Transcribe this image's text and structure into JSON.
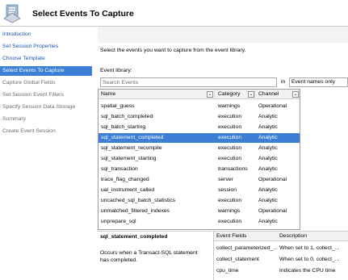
{
  "header": {
    "title": "Select Events To Capture"
  },
  "sidebar": {
    "items": [
      {
        "label": "Introduction",
        "state": "link"
      },
      {
        "label": "Set Session Properties",
        "state": "link"
      },
      {
        "label": "Choose Template",
        "state": "link"
      },
      {
        "label": "Select Events To Capture",
        "state": "active"
      },
      {
        "label": "Capture Global Fields",
        "state": "disabled"
      },
      {
        "label": "Set Session Event Filters",
        "state": "disabled"
      },
      {
        "label": "Specify Session Data Storage",
        "state": "disabled"
      },
      {
        "label": "Summary",
        "state": "disabled"
      },
      {
        "label": "Create Event Session",
        "state": "disabled"
      }
    ]
  },
  "main": {
    "instructions": "Select the events you want to capture from the event library.",
    "event_library_label": "Event library:",
    "search_placeholder": "Search Events",
    "in_label": "in",
    "search_scope": "Event names only"
  },
  "grid": {
    "columns": {
      "name": "Name",
      "category": "Category",
      "channel": "Channel"
    },
    "rows": [
      {
        "name": "spatial_guess",
        "category": "warnings",
        "channel": "Operational"
      },
      {
        "name": "sql_batch_completed",
        "category": "execution",
        "channel": "Analytic"
      },
      {
        "name": "sql_batch_starting",
        "category": "execution",
        "channel": "Analytic"
      },
      {
        "name": "sql_statement_completed",
        "category": "execution",
        "channel": "Analytic"
      },
      {
        "name": "sql_statement_recompile",
        "category": "execution",
        "channel": "Analytic"
      },
      {
        "name": "sql_statement_starting",
        "category": "execution",
        "channel": "Analytic"
      },
      {
        "name": "sql_transaction",
        "category": "transactions",
        "channel": "Analytic"
      },
      {
        "name": "trace_flag_changed",
        "category": "server",
        "channel": "Operational"
      },
      {
        "name": "ual_instrument_called",
        "category": "session",
        "channel": "Analytic"
      },
      {
        "name": "uncached_sql_batch_statistics",
        "category": "execution",
        "channel": "Analytic"
      },
      {
        "name": "unmatched_filtered_indexes",
        "category": "warnings",
        "channel": "Operational"
      },
      {
        "name": "unprepare_sql",
        "category": "execution",
        "channel": "Analytic"
      }
    ],
    "selected_index": 3
  },
  "description": {
    "title": "sql_statement_completed",
    "text": "Occurs when a Transact-SQL statement has completed."
  },
  "event_fields": {
    "columns": {
      "field": "Event Fields",
      "description": "Description"
    },
    "rows": [
      {
        "field": "collect_parameterized_...",
        "description": "When set to 1, collect_..."
      },
      {
        "field": "collect_statement",
        "description": "When set to 0, collect_..."
      },
      {
        "field": "cpu_time",
        "description": "Indicates the CPU time"
      }
    ]
  },
  "colors": {
    "selection": "#3d7fd6",
    "link": "#1a54b3",
    "disabled": "#6d6d6d"
  }
}
